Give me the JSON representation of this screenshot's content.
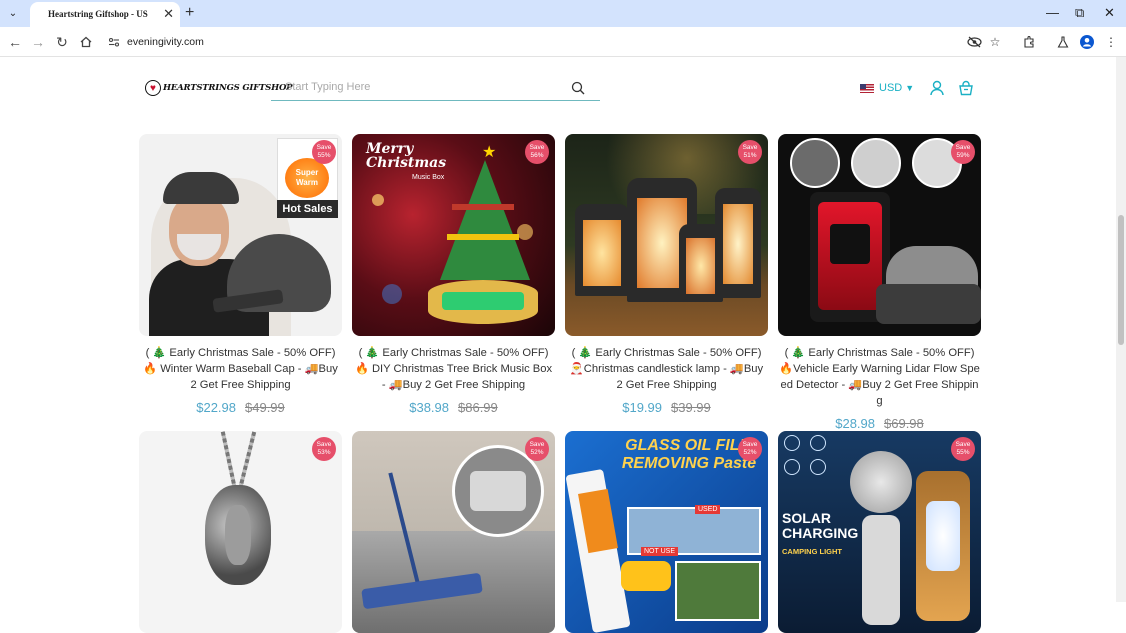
{
  "browser": {
    "tab_title": "Heartstring Giftshop - US",
    "url": "eveningivity.com"
  },
  "header": {
    "logo_text": "HEARTSTRINGS GIFTSHOP",
    "search_placeholder": "Start Typing Here",
    "currency": "USD"
  },
  "products": [
    {
      "title": "( 🎄 Early Christmas Sale - 50% OFF) 🔥 Winter Warm Baseball Cap - 🚚Buy 2 Get Free Shipping",
      "price": "$22.98",
      "compare": "$49.99",
      "badge_save": "Save",
      "badge_pct": "55%",
      "img_text1": "Super Warm",
      "img_text2": "Hot Sales"
    },
    {
      "title": "( 🎄 Early Christmas Sale - 50% OFF) 🔥 DIY Christmas Tree Brick Music Box - 🚚Buy 2 Get Free Shipping",
      "price": "$38.98",
      "compare": "$86.99",
      "badge_save": "Save",
      "badge_pct": "56%",
      "img_text1": "Merry Christmas",
      "img_text2": "Music Box"
    },
    {
      "title": "( 🎄 Early Christmas Sale - 50% OFF) 🎅Christmas candlestick lamp - 🚚Buy 2 Get Free Shipping",
      "price": "$19.99",
      "compare": "$39.99",
      "badge_save": "Save",
      "badge_pct": "51%"
    },
    {
      "title": "( 🎄 Early Christmas Sale - 50% OFF) 🔥Vehicle Early Warning Lidar Flow Speed Detector - 🚚Buy 2 Get Free Shipping",
      "price": "$28.98",
      "compare": "$69.98",
      "badge_save": "Save",
      "badge_pct": "59%"
    },
    {
      "badge_save": "Save",
      "badge_pct": "53%"
    },
    {
      "badge_save": "Save",
      "badge_pct": "52%"
    },
    {
      "badge_save": "Save",
      "badge_pct": "52%",
      "img_text1": "GLASS OIL FILM REMOVING Paste",
      "img_text2": "USED",
      "img_text3": "NOT USE"
    },
    {
      "badge_save": "Save",
      "badge_pct": "55%",
      "img_text1": "SOLAR CHARGING",
      "img_text2": "CAMPING LIGHT"
    }
  ],
  "colors": {
    "accent": "#1ab0c4",
    "price": "#52a7c9",
    "badge": "#e64f6a",
    "tabbar": "#d3e3fd"
  }
}
